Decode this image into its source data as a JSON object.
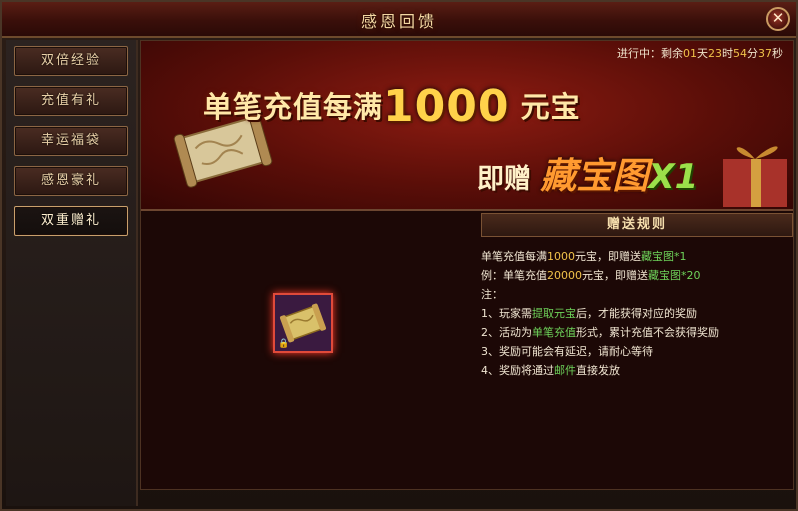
{
  "window": {
    "title": "感恩回馈"
  },
  "sidebar": {
    "items": [
      {
        "label": "双倍经验"
      },
      {
        "label": "充值有礼"
      },
      {
        "label": "幸运福袋"
      },
      {
        "label": "感恩豪礼"
      },
      {
        "label": "双重赠礼"
      }
    ],
    "active_index": 4
  },
  "timer": {
    "prefix": "进行中：剩余",
    "days": "01",
    "days_unit": "天",
    "hours": "23",
    "hours_unit": "时",
    "minutes": "54",
    "minutes_unit": "分",
    "seconds": "37",
    "seconds_unit": "秒"
  },
  "banner": {
    "line1_prefix": "单笔充值每满",
    "line1_amount": "1000",
    "line1_suffix": "元宝",
    "line2_prefix": "即赠",
    "line2_prize": "藏宝图",
    "line2_mult": "X1"
  },
  "rules": {
    "header": "赠送规则",
    "l1_a": "单笔充值每满",
    "l1_b": "1000",
    "l1_c": "元宝，即赠送",
    "l1_d": "藏宝图*1",
    "l2_a": "例：单笔充值",
    "l2_b": "20000",
    "l2_c": "元宝，即赠送",
    "l2_d": "藏宝图*20",
    "note": "注：",
    "n1_a": "1、玩家需",
    "n1_b": "提取元宝",
    "n1_c": "后，才能获得对应的奖励",
    "n2_a": "2、活动为",
    "n2_b": "单笔充值",
    "n2_c": "形式，累计充值不会获得奖励",
    "n3": "3、奖励可能会有延迟，请耐心等待",
    "n4_a": "4、奖励将通过",
    "n4_b": "邮件",
    "n4_c": "直接发放"
  },
  "colors": {
    "green": "#6ed35a",
    "gold": "#f0c24a",
    "accent_red": "#e04a3a"
  },
  "icons": {
    "close": "close-icon",
    "reward_item": "treasure-map-icon",
    "lock": "lock-icon"
  }
}
